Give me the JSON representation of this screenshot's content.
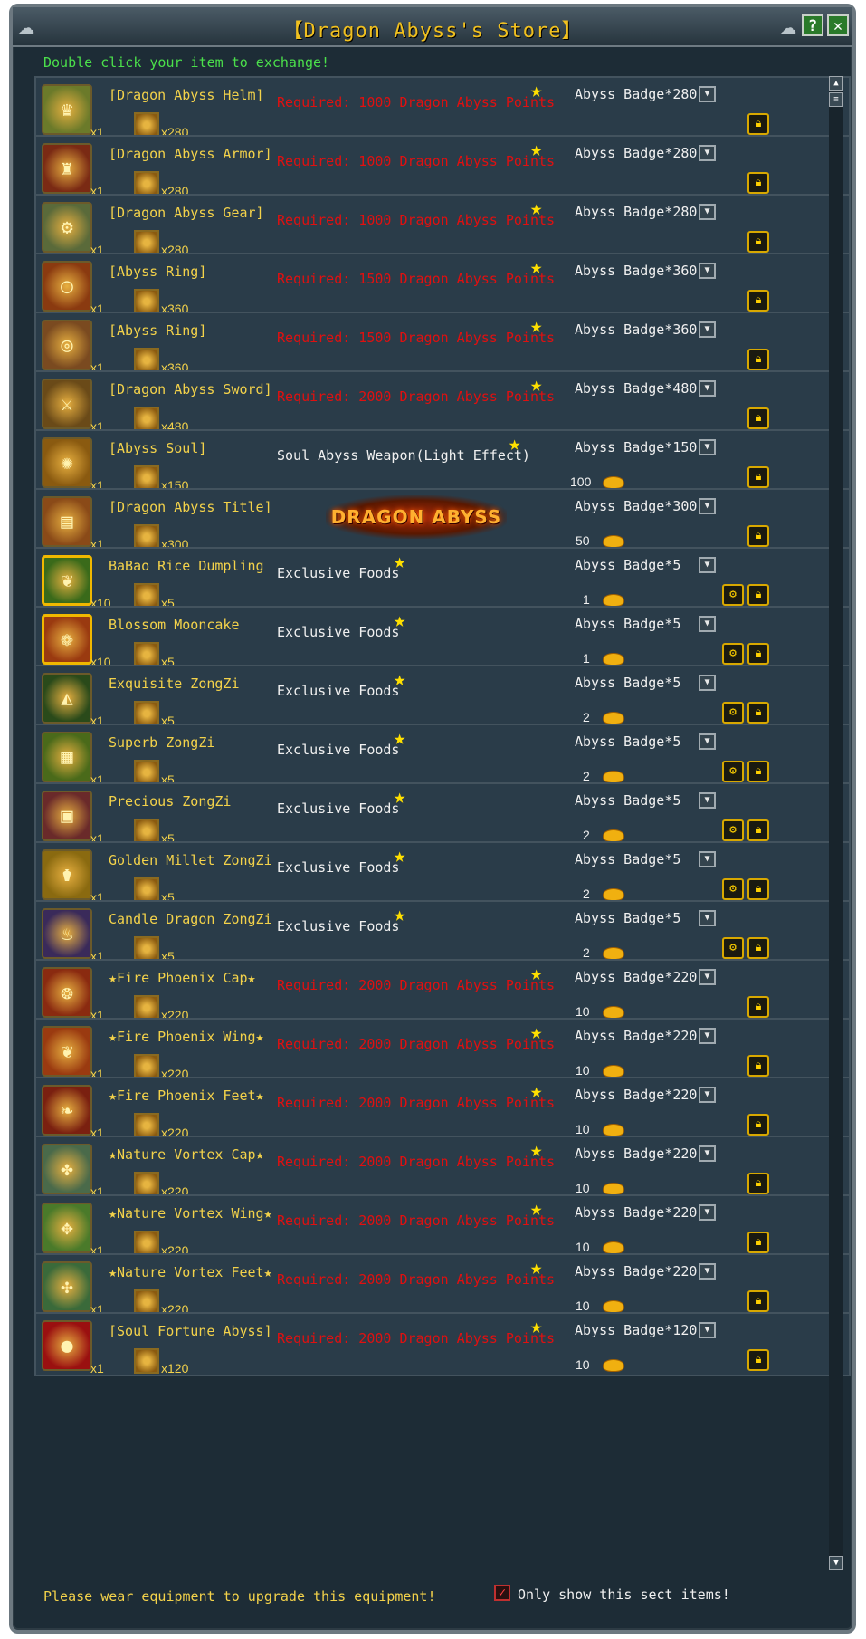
{
  "window": {
    "title": "【Dragon Abyss's Store】",
    "help_label": "?",
    "close_label": "✕"
  },
  "hint": "Double click your item to exchange!",
  "footer": {
    "notice": "Please wear equipment to upgrade this equipment!",
    "checkbox_label": "Only show this sect items!",
    "checkbox_checked": true
  },
  "banner_text": "DRAGON ABYSS",
  "items": [
    {
      "name": "[Dragon Abyss Helm]",
      "qty": "x1",
      "mat_qty": "x280",
      "requirement": "Required: 1000 Dragon Abyss Points",
      "req_style": "red",
      "cost": "Abyss Badge*280",
      "gold": "",
      "icon": "helm-icon",
      "glyph": "♛",
      "gold_border": false,
      "alt_button": false
    },
    {
      "name": "[Dragon Abyss Armor]",
      "qty": "x1",
      "mat_qty": "x280",
      "requirement": "Required: 1000 Dragon Abyss Points",
      "req_style": "red",
      "cost": "Abyss Badge*280",
      "gold": "",
      "icon": "armor-icon",
      "glyph": "♜",
      "gold_border": false,
      "alt_button": false
    },
    {
      "name": "[Dragon Abyss Gear]",
      "qty": "x1",
      "mat_qty": "x280",
      "requirement": "Required: 1000 Dragon Abyss Points",
      "req_style": "red",
      "cost": "Abyss Badge*280",
      "gold": "",
      "icon": "gear-icon",
      "glyph": "⚙",
      "gold_border": false,
      "alt_button": false
    },
    {
      "name": "[Abyss Ring]",
      "qty": "x1",
      "mat_qty": "x360",
      "requirement": "Required: 1500 Dragon Abyss Points",
      "req_style": "red",
      "cost": "Abyss Badge*360",
      "gold": "",
      "icon": "ring-icon",
      "glyph": "◯",
      "gold_border": false,
      "alt_button": false
    },
    {
      "name": "[Abyss Ring]",
      "qty": "x1",
      "mat_qty": "x360",
      "requirement": "Required: 1500 Dragon Abyss Points",
      "req_style": "red",
      "cost": "Abyss Badge*360",
      "gold": "",
      "icon": "ring-icon",
      "glyph": "◎",
      "gold_border": false,
      "alt_button": false
    },
    {
      "name": "[Dragon Abyss Sword]",
      "qty": "x1",
      "mat_qty": "x480",
      "requirement": "Required: 2000 Dragon Abyss Points",
      "req_style": "red",
      "cost": "Abyss Badge*480",
      "gold": "",
      "icon": "sword-icon",
      "glyph": "⚔",
      "gold_border": false,
      "alt_button": false
    },
    {
      "name": "[Abyss Soul]",
      "qty": "x1",
      "mat_qty": "x150",
      "requirement": "Soul Abyss Weapon(Light Effect)",
      "req_style": "white",
      "cost": "Abyss Badge*150",
      "gold": "100",
      "icon": "soul-icon",
      "glyph": "✺",
      "gold_border": false,
      "alt_button": false
    },
    {
      "name": "[Dragon Abyss Title]",
      "qty": "x1",
      "mat_qty": "x300",
      "requirement": "",
      "req_style": "banner",
      "cost": "Abyss Badge*300",
      "gold": "50",
      "icon": "title-scroll-icon",
      "glyph": "▤",
      "gold_border": false,
      "alt_button": false
    },
    {
      "name": "BaBao Rice Dumpling",
      "qty": "x10",
      "mat_qty": "x5",
      "requirement": "Exclusive Foods",
      "req_style": "white",
      "cost": "Abyss Badge*5",
      "gold": "1",
      "icon": "rice-dumpling-icon",
      "glyph": "❦",
      "gold_border": true,
      "alt_button": true
    },
    {
      "name": "Blossom Mooncake",
      "qty": "x10",
      "mat_qty": "x5",
      "requirement": "Exclusive Foods",
      "req_style": "white",
      "cost": "Abyss Badge*5",
      "gold": "1",
      "icon": "mooncake-icon",
      "glyph": "❁",
      "gold_border": true,
      "alt_button": true
    },
    {
      "name": "Exquisite ZongZi",
      "qty": "x1",
      "mat_qty": "x5",
      "requirement": "Exclusive Foods",
      "req_style": "white",
      "cost": "Abyss Badge*5",
      "gold": "2",
      "icon": "zongzi-icon",
      "glyph": "◭",
      "gold_border": false,
      "alt_button": true
    },
    {
      "name": "Superb ZongZi",
      "qty": "x1",
      "mat_qty": "x5",
      "requirement": "Exclusive Foods",
      "req_style": "white",
      "cost": "Abyss Badge*5",
      "gold": "2",
      "icon": "zongzi-basket-icon",
      "glyph": "▦",
      "gold_border": false,
      "alt_button": true
    },
    {
      "name": "Precious ZongZi",
      "qty": "x1",
      "mat_qty": "x5",
      "requirement": "Exclusive Foods",
      "req_style": "white",
      "cost": "Abyss Badge*5",
      "gold": "2",
      "icon": "zongzi-box-icon",
      "glyph": "▣",
      "gold_border": false,
      "alt_button": true
    },
    {
      "name": "Golden Millet ZongZi",
      "qty": "x1",
      "mat_qty": "x5",
      "requirement": "Exclusive Foods",
      "req_style": "white",
      "cost": "Abyss Badge*5",
      "gold": "2",
      "icon": "jar-icon",
      "glyph": "⚱",
      "gold_border": false,
      "alt_button": true
    },
    {
      "name": "Candle Dragon ZongZi",
      "qty": "x1",
      "mat_qty": "x5",
      "requirement": "Exclusive Foods",
      "req_style": "white",
      "cost": "Abyss Badge*5",
      "gold": "2",
      "icon": "candle-icon",
      "glyph": "♨",
      "gold_border": false,
      "alt_button": true
    },
    {
      "name": "★Fire Phoenix Cap★",
      "qty": "x1",
      "mat_qty": "x220",
      "requirement": "Required: 2000 Dragon Abyss Points",
      "req_style": "red",
      "cost": "Abyss Badge*220",
      "gold": "10",
      "icon": "phoenix-cap-icon",
      "glyph": "❂",
      "gold_border": false,
      "alt_button": false
    },
    {
      "name": "★Fire Phoenix Wing★",
      "qty": "x1",
      "mat_qty": "x220",
      "requirement": "Required: 2000 Dragon Abyss Points",
      "req_style": "red",
      "cost": "Abyss Badge*220",
      "gold": "10",
      "icon": "phoenix-wing-icon",
      "glyph": "❦",
      "gold_border": false,
      "alt_button": false
    },
    {
      "name": "★Fire Phoenix Feet★",
      "qty": "x1",
      "mat_qty": "x220",
      "requirement": "Required: 2000 Dragon Abyss Points",
      "req_style": "red",
      "cost": "Abyss Badge*220",
      "gold": "10",
      "icon": "phoenix-feet-icon",
      "glyph": "❧",
      "gold_border": false,
      "alt_button": false
    },
    {
      "name": "★Nature Vortex Cap★",
      "qty": "x1",
      "mat_qty": "x220",
      "requirement": "Required: 2000 Dragon Abyss Points",
      "req_style": "red",
      "cost": "Abyss Badge*220",
      "gold": "10",
      "icon": "vortex-cap-icon",
      "glyph": "✤",
      "gold_border": false,
      "alt_button": false
    },
    {
      "name": "★Nature Vortex Wing★",
      "qty": "x1",
      "mat_qty": "x220",
      "requirement": "Required: 2000 Dragon Abyss Points",
      "req_style": "red",
      "cost": "Abyss Badge*220",
      "gold": "10",
      "icon": "vortex-wing-icon",
      "glyph": "✥",
      "gold_border": false,
      "alt_button": false
    },
    {
      "name": "★Nature Vortex Feet★",
      "qty": "x1",
      "mat_qty": "x220",
      "requirement": "Required: 2000 Dragon Abyss Points",
      "req_style": "red",
      "cost": "Abyss Badge*220",
      "gold": "10",
      "icon": "vortex-feet-icon",
      "glyph": "✣",
      "gold_border": false,
      "alt_button": false
    },
    {
      "name": "[Soul Fortune Abyss]",
      "qty": "x1",
      "mat_qty": "x120",
      "requirement": "Required: 2000 Dragon Abyss Points",
      "req_style": "red",
      "cost": "Abyss Badge*120",
      "gold": "10",
      "icon": "fortune-orb-icon",
      "glyph": "●",
      "gold_border": false,
      "alt_button": false
    }
  ],
  "icon_bg": [
    "#6b7a2a",
    "#7a2a14",
    "#5a6a3a",
    "#8a3a10",
    "#7a4a20",
    "#6a4a18",
    "#8a5a10",
    "#8a4a18",
    "#3a6a1a",
    "#9a3a10",
    "#2a4a1a",
    "#4a6a1a",
    "#6a2a2a",
    "#8a6a10",
    "#3a2a5a",
    "#8a2a10",
    "#9a3a10",
    "#7a2010",
    "#4a6a4a",
    "#4a7a2a",
    "#3a6a3a",
    "#9a1010"
  ]
}
